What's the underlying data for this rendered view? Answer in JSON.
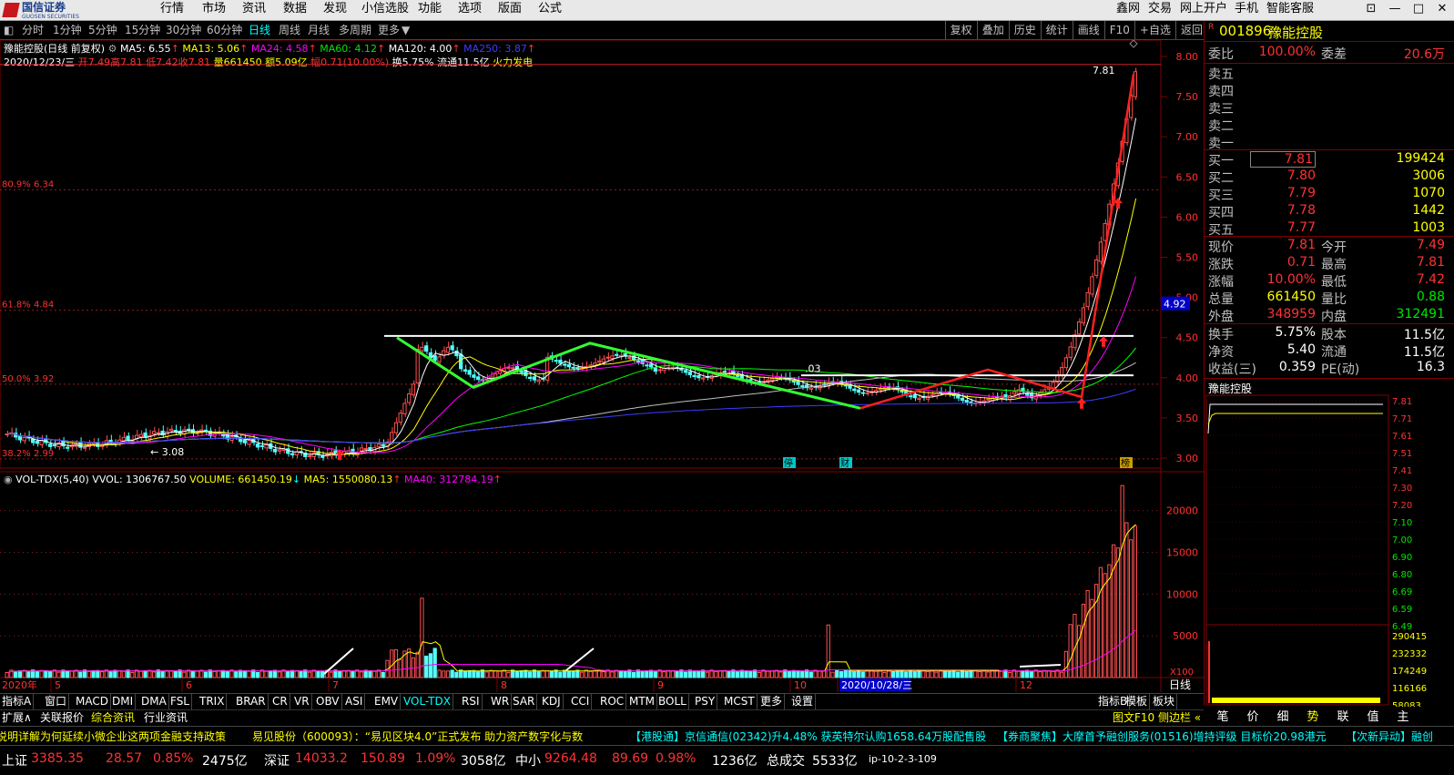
{
  "app": {
    "logo_text": "国信证券",
    "logo_sub": "GUOSEN SECURITIES"
  },
  "menu": [
    "行情",
    "市场",
    "资讯",
    "数据",
    "发现",
    "小信选股",
    "功能",
    "选项",
    "版面",
    "公式"
  ],
  "menu_right": [
    "鑫网",
    "交易",
    "网上开户",
    "手机",
    "智能客服"
  ],
  "periods": [
    "分时",
    "1分钟",
    "5分钟",
    "15分钟",
    "30分钟",
    "60分钟",
    "日线",
    "周线",
    "月线",
    "多周期",
    "更多"
  ],
  "active_period": "日线",
  "tools": [
    "复权",
    "叠加",
    "历史",
    "统计",
    "画线",
    "F10",
    "+自选",
    "返回"
  ],
  "ma_line": {
    "name": "豫能控股(日线 前复权)",
    "ma5": "MA5: 6.55",
    "ma13": "MA13: 5.06",
    "ma24": "MA24: 4.58",
    "ma60": "MA60: 4.12",
    "ma120": "MA120: 4.00",
    "ma250": "MA250: 3.87"
  },
  "info_line": {
    "date": "2020/12/23/三",
    "open": "开7.49",
    "high": "高7.81",
    "low": "低7.42",
    "close": "收7.81",
    "vol": "量661450",
    "amt": "额5.09亿",
    "chg": "幅0.71(10.00%)",
    "turn": "换5.75%",
    "float": "流通11.5亿",
    "concept": "火力发电"
  },
  "price_axis": [
    "8.00",
    "7.50",
    "7.00",
    "6.50",
    "6.00",
    "5.50",
    "5.00",
    "4.50",
    "4.00",
    "3.50",
    "3.00"
  ],
  "price_marker": "4.92",
  "fib": [
    {
      "label": "80.9% 6.34",
      "price": 6.34
    },
    {
      "label": "61.8% 4.84",
      "price": 4.84
    },
    {
      "label": "50.0% 3.92",
      "price": 3.92
    },
    {
      "label": "38.2% 2.99",
      "price": 2.99
    }
  ],
  "annotations": {
    "high": "7.81",
    "low": "3.08",
    "mid": ".03",
    "ting": "停",
    "cai": "财",
    "bang": "榜"
  },
  "vol_line": {
    "name": "VOL-TDX(5,40)",
    "vvol": "VVOL: 1306767.50",
    "volume": "VOLUME: 661450.19",
    "ma5": "MA5: 1550080.13",
    "ma40": "MA40: 312784.19"
  },
  "vol_axis": [
    "20000",
    "15000",
    "10000",
    "5000",
    "X100"
  ],
  "x_axis": [
    "2020年",
    "5",
    "6",
    "7",
    "8",
    "9",
    "10",
    "2020/10/28/三",
    "12"
  ],
  "x_axis_right": "日线",
  "bottom_tabs": [
    "指标A",
    "窗口",
    "MACD",
    "DMI",
    "DMA",
    "FSL",
    "TRIX",
    "BRAR",
    "CR",
    "VR",
    "OBV",
    "ASI",
    "EMV",
    "VOL-TDX",
    "RSI",
    "WR",
    "SAR",
    "KDJ",
    "CCI",
    "ROC",
    "MTM",
    "BOLL",
    "PSY",
    "MCST",
    "更多",
    "设置"
  ],
  "active_tab": "VOL-TDX",
  "bottom_right": [
    "指标B",
    "模板",
    "板块"
  ],
  "nav": [
    "扩展∧",
    "关联报价",
    "综合资讯",
    "行业资讯"
  ],
  "nav_right": "图文F10 侧边栏 «",
  "quote": {
    "code": "001896",
    "name": "豫能控股",
    "weibi": {
      "label": "委比",
      "value": "100.00%",
      "label2": "委差",
      "value2": "20.6万"
    },
    "sell": [
      "卖五",
      "卖四",
      "卖三",
      "卖二",
      "卖一"
    ],
    "buy": [
      {
        "l": "买一",
        "p": "7.81",
        "v": "199424"
      },
      {
        "l": "买二",
        "p": "7.80",
        "v": "3006"
      },
      {
        "l": "买三",
        "p": "7.79",
        "v": "1070"
      },
      {
        "l": "买四",
        "p": "7.78",
        "v": "1442"
      },
      {
        "l": "买五",
        "p": "7.77",
        "v": "1003"
      }
    ],
    "stats": [
      {
        "l": "现价",
        "v": "7.81",
        "l2": "今开",
        "v2": "7.49"
      },
      {
        "l": "涨跌",
        "v": "0.71",
        "l2": "最高",
        "v2": "7.81"
      },
      {
        "l": "涨幅",
        "v": "10.00%",
        "l2": "最低",
        "v2": "7.42"
      },
      {
        "l": "总量",
        "v": "661450",
        "l2": "量比",
        "v2": "0.88"
      },
      {
        "l": "外盘",
        "v": "348959",
        "l2": "内盘",
        "v2": "312491"
      }
    ],
    "fund": [
      {
        "l": "换手",
        "v": "5.75%",
        "l2": "股本",
        "v2": "11.5亿"
      },
      {
        "l": "净资",
        "v": "5.40",
        "l2": "流通",
        "v2": "11.5亿"
      },
      {
        "l": "收益(三)",
        "v": "0.359",
        "l2": "PE(动)",
        "v2": "16.3"
      }
    ],
    "mini_title": "豫能控股",
    "mini_axis": [
      "7.81",
      "7.71",
      "7.61",
      "7.51",
      "7.41",
      "7.30",
      "7.20",
      "7.10",
      "7.00",
      "6.90",
      "6.80",
      "6.69",
      "6.59",
      "6.49"
    ],
    "mini_vol_axis": [
      "290415",
      "232332",
      "174249",
      "116166",
      "58083"
    ],
    "tabs": [
      "笔",
      "价",
      "细",
      "势",
      "联",
      "值",
      "主"
    ]
  },
  "news": [
    "说明详解为何延续小微企业这两项金融支持政策",
    "易见股份（600093）：“易见区块4.0”正式发布 助力资产数字化与数",
    "【港股通】京信通信(02342)升4.48% 获英特尔认购1658.64万股配售股",
    "【券商聚焦】大摩首予融创服务(01516)增持评级 目标价20.98港元",
    "【次新异动】融创"
  ],
  "status": [
    {
      "l": "上证",
      "p": "3385.35",
      "c": "28.57",
      "pc": "0.85%",
      "a": "2475亿"
    },
    {
      "l": "深证",
      "p": "14033.2",
      "c": "150.89",
      "pc": "1.09%",
      "a": "3058亿"
    },
    {
      "l": "中小",
      "p": "9264.48",
      "c": "89.69",
      "pc": "0.98%",
      "a": "1236亿"
    }
  ],
  "status_total": {
    "l": "总成交",
    "v": "5533亿"
  },
  "status_ip": "ip-10-2-3-109"
}
